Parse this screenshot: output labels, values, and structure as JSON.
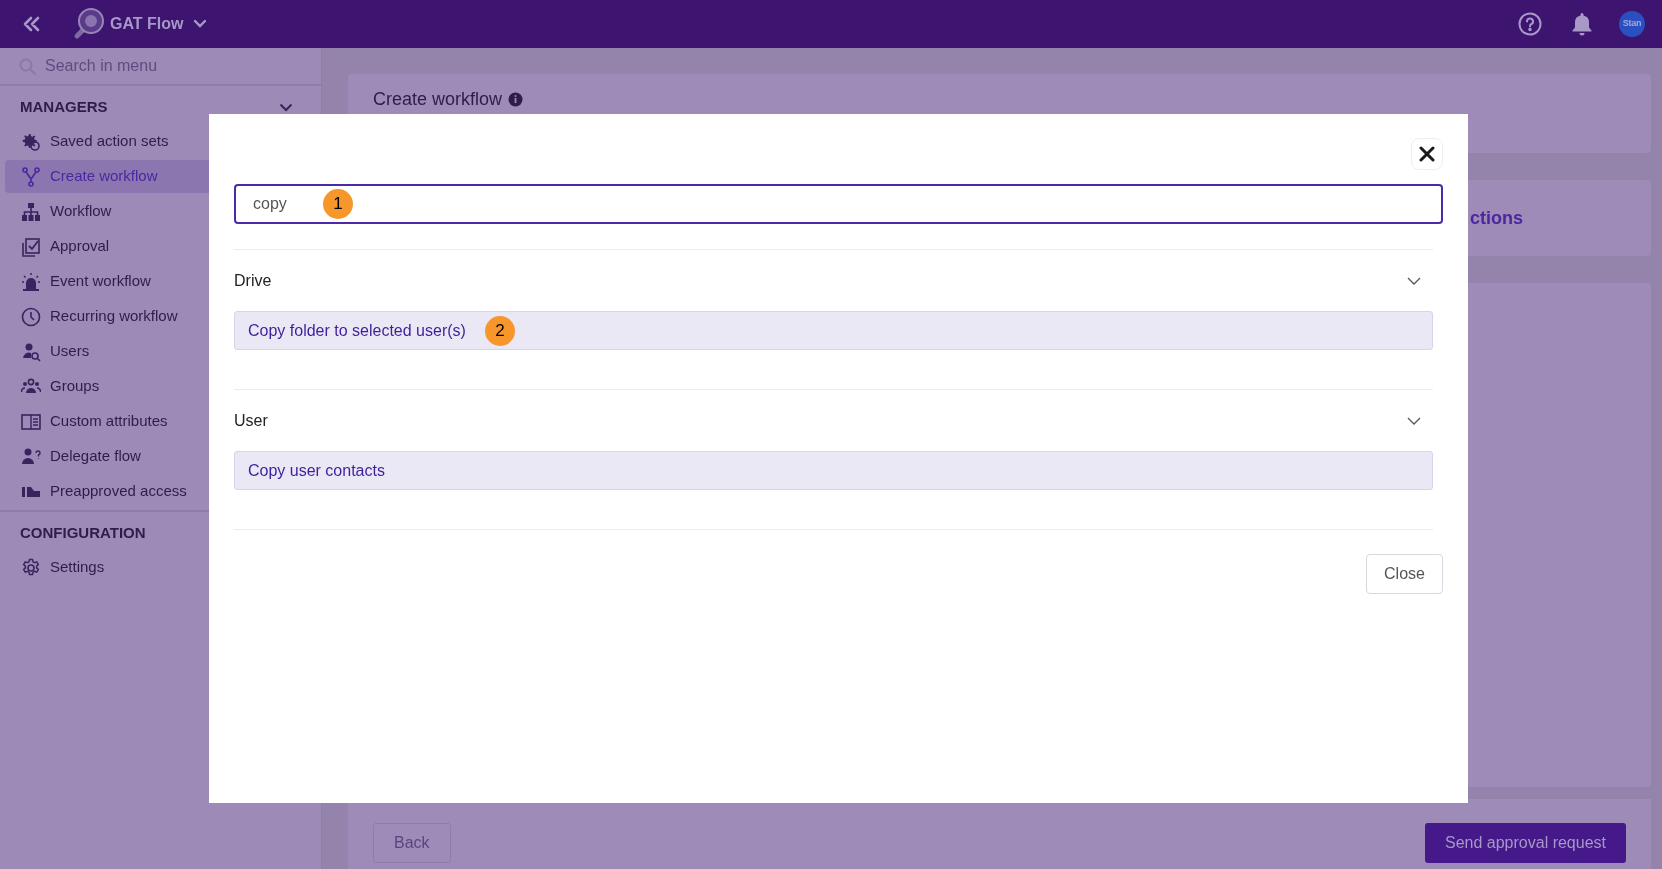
{
  "topbar": {
    "app_name": "GAT Flow",
    "avatar": "Stan"
  },
  "sidebar": {
    "search_placeholder": "Search in menu",
    "sections": [
      {
        "title": "MANAGERS",
        "kind": "collapsible",
        "items": [
          {
            "label": "Saved action sets",
            "selected": false
          },
          {
            "label": "Create workflow",
            "selected": true
          },
          {
            "label": "Workflow",
            "selected": false
          },
          {
            "label": "Approval",
            "selected": false
          },
          {
            "label": "Event workflow",
            "selected": false
          },
          {
            "label": "Recurring workflow",
            "selected": false
          },
          {
            "label": "Users",
            "selected": false
          },
          {
            "label": "Groups",
            "selected": false
          },
          {
            "label": "Custom attributes",
            "selected": false
          },
          {
            "label": "Delegate flow",
            "selected": false
          },
          {
            "label": "Preapproved access",
            "selected": false
          }
        ]
      },
      {
        "title": "CONFIGURATION",
        "kind": "plain",
        "items": [
          {
            "label": "Settings",
            "selected": false
          }
        ]
      }
    ]
  },
  "page": {
    "title": "Create workflow",
    "card_2_text": "ctions",
    "back_button": "Back",
    "send_button": "Send approval request"
  },
  "modal": {
    "search": {
      "value": "copy",
      "marker": "1"
    },
    "groups": [
      {
        "title": "Drive",
        "expanded": true,
        "actions": [
          {
            "label": "Copy folder to selected user(s)",
            "marker": "2"
          }
        ]
      },
      {
        "title": "User",
        "expanded": true,
        "actions": [
          {
            "label": "Copy user contacts"
          }
        ]
      }
    ],
    "close_button": "Close"
  }
}
